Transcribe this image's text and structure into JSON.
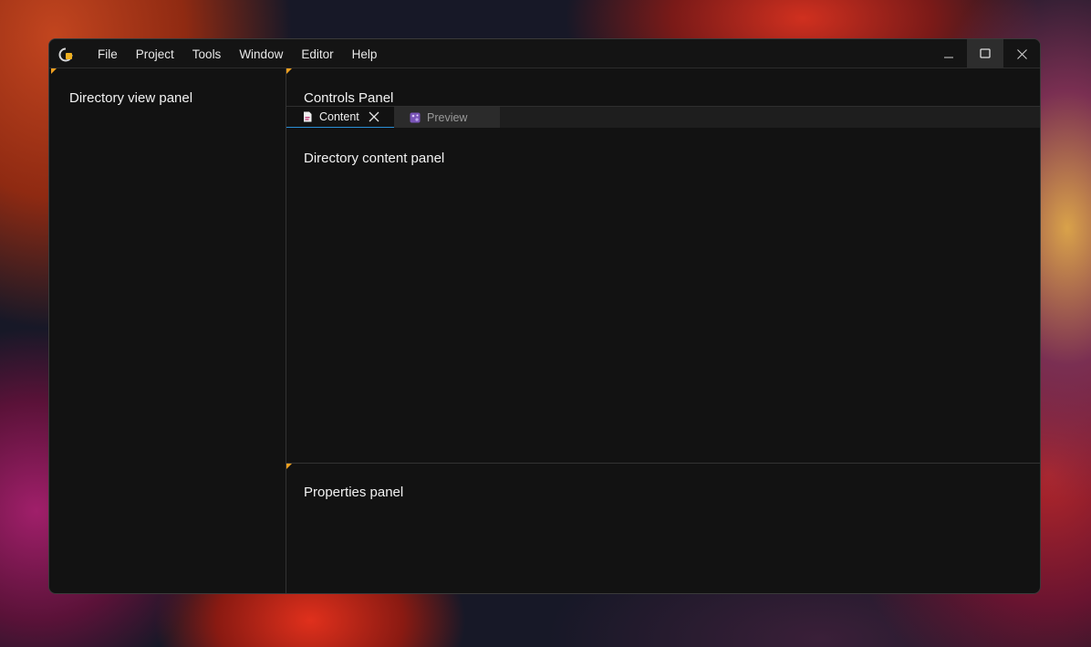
{
  "menu": {
    "items": [
      {
        "label": "File"
      },
      {
        "label": "Project"
      },
      {
        "label": "Tools"
      },
      {
        "label": "Window"
      },
      {
        "label": "Editor"
      },
      {
        "label": "Help"
      }
    ]
  },
  "window_controls": {
    "minimize": "minimize-icon",
    "maximize": "maximize-icon",
    "close": "close-icon"
  },
  "panels": {
    "directory_view": {
      "title": "Directory view panel"
    },
    "controls": {
      "title": "Controls Panel"
    },
    "directory_content": {
      "title": "Directory content panel"
    },
    "properties": {
      "title": "Properties panel"
    }
  },
  "tabs": [
    {
      "label": "Content",
      "icon": "document-icon",
      "active": true
    },
    {
      "label": "Preview",
      "icon": "preview-icon",
      "active": false
    }
  ],
  "colors": {
    "accent": "#f0a020",
    "tab_active_underline": "#2a8fd6",
    "window_bg": "#121212"
  }
}
